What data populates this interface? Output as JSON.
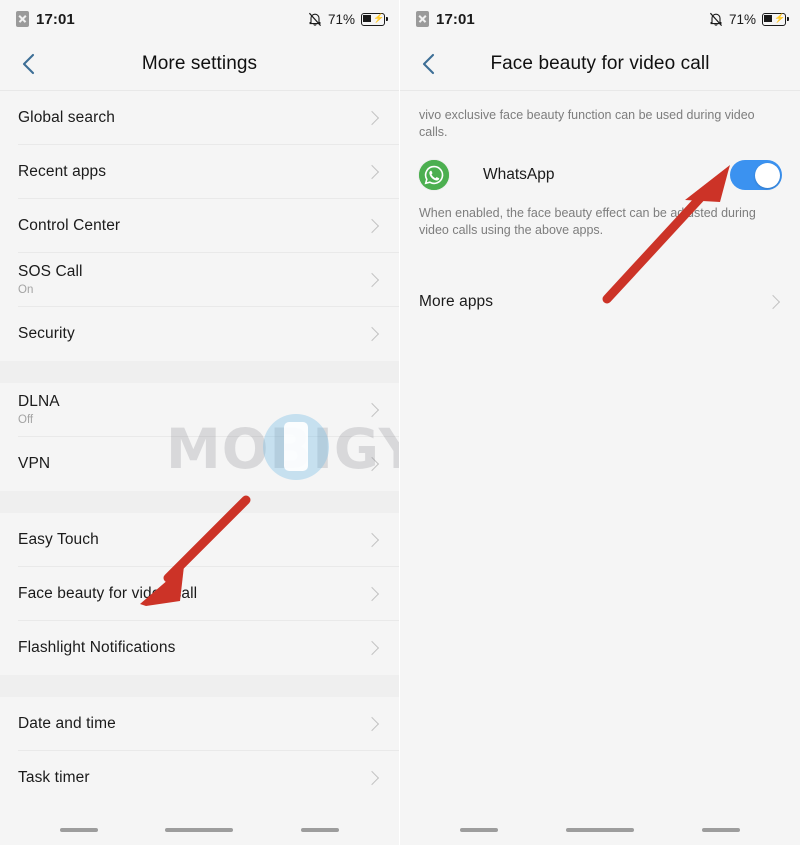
{
  "status_bar": {
    "time": "17:01",
    "battery_percent": "71%",
    "sim_icon": "sim-missing-icon",
    "silent_icon": "bell-muted-icon",
    "battery_icon": "battery-charging-icon"
  },
  "left_screen": {
    "title": "More settings",
    "back_icon": "chevron-left-icon",
    "groups": [
      {
        "items": [
          {
            "label": "Global search",
            "sub": ""
          },
          {
            "label": "Recent apps",
            "sub": ""
          },
          {
            "label": "Control Center",
            "sub": ""
          },
          {
            "label": "SOS Call",
            "sub": "On"
          },
          {
            "label": "Security",
            "sub": ""
          }
        ]
      },
      {
        "items": [
          {
            "label": "DLNA",
            "sub": "Off"
          },
          {
            "label": "VPN",
            "sub": ""
          }
        ]
      },
      {
        "items": [
          {
            "label": "Easy Touch",
            "sub": ""
          },
          {
            "label": "Face beauty for video call",
            "sub": ""
          },
          {
            "label": "Flashlight Notifications",
            "sub": ""
          }
        ]
      },
      {
        "items": [
          {
            "label": "Date and time",
            "sub": ""
          },
          {
            "label": "Task timer",
            "sub": ""
          }
        ]
      }
    ]
  },
  "right_screen": {
    "title": "Face beauty for video call",
    "back_icon": "chevron-left-icon",
    "description_top": "vivo exclusive face beauty function can be used during video calls.",
    "app": {
      "name": "WhatsApp",
      "icon": "whatsapp-icon",
      "toggle_state": "on"
    },
    "description_bottom": "When enabled, the face beauty effect can be adjusted during video calls using the above apps.",
    "more_apps_label": "More apps"
  },
  "nav_bar": {
    "recents_label": "recents-key",
    "home_label": "home-key",
    "back_label": "back-key"
  },
  "watermark": {
    "text_before": "M",
    "text_after": "BIGYAAN",
    "full_text": "MOBIGYAAN"
  },
  "annotations": {
    "arrow_left_target": "Face beauty for video call",
    "arrow_right_target": "WhatsApp toggle"
  },
  "colors": {
    "accent_blue": "#3b92f0",
    "back_chevron": "#3d6e96",
    "arrow_red": "#cc3327",
    "whatsapp_green": "#4caf50",
    "list_bg": "#f5f5f5",
    "group_gap_bg": "#efefef"
  }
}
